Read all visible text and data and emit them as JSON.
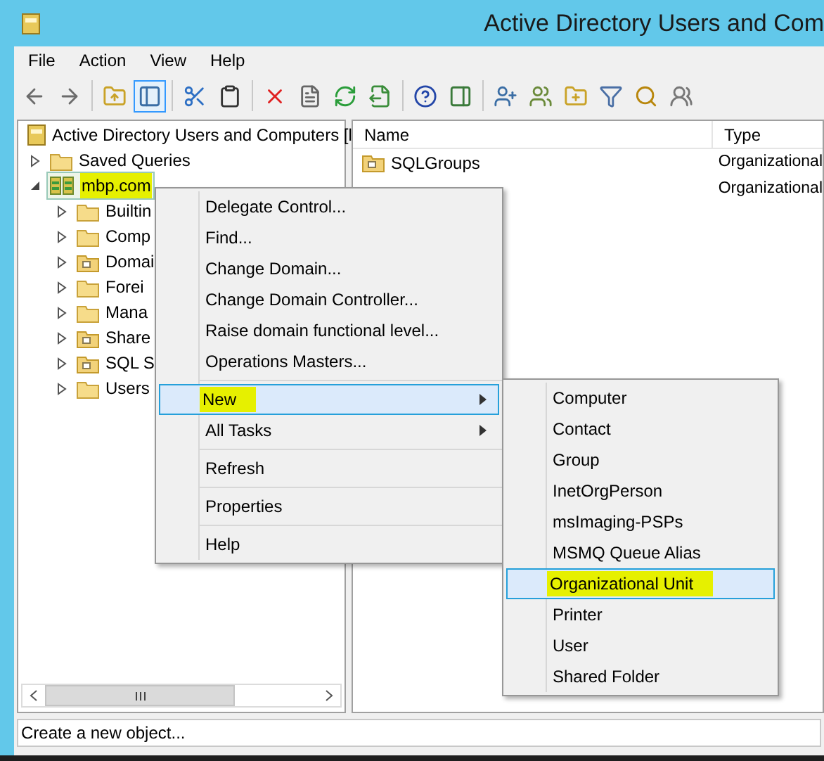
{
  "window": {
    "title": "Active Directory Users and Com"
  },
  "menu_bar": [
    "File",
    "Action",
    "View",
    "Help"
  ],
  "toolbar_buttons": [
    {
      "pressed": false
    },
    {
      "pressed": false
    },
    {
      "pressed": false
    },
    {
      "pressed": true
    },
    {
      "pressed": false
    },
    {
      "pressed": false
    },
    {
      "pressed": false
    },
    {
      "pressed": false
    },
    {
      "pressed": false
    },
    {
      "pressed": false
    },
    {
      "pressed": false
    },
    {
      "pressed": false
    },
    {
      "pressed": false
    },
    {
      "pressed": false
    },
    {
      "pressed": false
    },
    {
      "pressed": false
    },
    {
      "pressed": false
    },
    {
      "pressed": false
    }
  ],
  "tree": [
    {
      "label": "Active Directory Users and Computers [l",
      "kind": "root",
      "selected": false,
      "highlighted": false,
      "children": [
        {
          "label": "Saved Queries",
          "kind": "folder",
          "expanded": false,
          "selected": false,
          "highlighted": false
        },
        {
          "label": "mbp.com",
          "kind": "domain",
          "expanded": true,
          "selected": true,
          "highlighted": true,
          "children": [
            {
              "label": "Builtin",
              "kind": "folder",
              "expanded": false,
              "selected": false,
              "highlighted": false
            },
            {
              "label": "Comp",
              "kind": "folder",
              "expanded": false,
              "selected": false,
              "highlighted": false
            },
            {
              "label": "Domai",
              "kind": "ou",
              "expanded": false,
              "selected": false,
              "highlighted": false
            },
            {
              "label": "Forei",
              "kind": "folder",
              "expanded": false,
              "selected": false,
              "highlighted": false
            },
            {
              "label": "Mana",
              "kind": "folder",
              "expanded": false,
              "selected": false,
              "highlighted": false
            },
            {
              "label": "Share",
              "kind": "ou",
              "expanded": false,
              "selected": false,
              "highlighted": false
            },
            {
              "label": "SQL S",
              "kind": "ou",
              "expanded": false,
              "selected": false,
              "highlighted": false
            },
            {
              "label": "Users",
              "kind": "folder",
              "expanded": false,
              "selected": false,
              "highlighted": false
            }
          ]
        }
      ]
    }
  ],
  "list": {
    "columns": [
      "Name",
      "Type"
    ],
    "rows": [
      {
        "name": "SQLGroups",
        "type": "Organizational"
      },
      {
        "type": "Organizational"
      }
    ]
  },
  "context_menu": [
    {
      "kind": "item",
      "label": "Delegate Control...",
      "selected": false,
      "highlighted": false,
      "submenu": false
    },
    {
      "kind": "item",
      "label": "Find...",
      "selected": false,
      "highlighted": false,
      "submenu": false
    },
    {
      "kind": "item",
      "label": "Change Domain...",
      "selected": false,
      "highlighted": false,
      "submenu": false
    },
    {
      "kind": "item",
      "label": "Change Domain Controller...",
      "selected": false,
      "highlighted": false,
      "submenu": false
    },
    {
      "kind": "item",
      "label": "Raise domain functional level...",
      "selected": false,
      "highlighted": false,
      "submenu": false
    },
    {
      "kind": "item",
      "label": "Operations Masters...",
      "selected": false,
      "highlighted": false,
      "submenu": false
    },
    {
      "kind": "separator"
    },
    {
      "kind": "item",
      "label": "New",
      "selected": true,
      "highlighted": true,
      "submenu": true
    },
    {
      "kind": "item",
      "label": "All Tasks",
      "selected": false,
      "highlighted": false,
      "submenu": true
    },
    {
      "kind": "separator"
    },
    {
      "kind": "item",
      "label": "Refresh",
      "selected": false,
      "highlighted": false,
      "submenu": false
    },
    {
      "kind": "separator"
    },
    {
      "kind": "item",
      "label": "Properties",
      "selected": false,
      "highlighted": false,
      "submenu": false
    },
    {
      "kind": "separator"
    },
    {
      "kind": "item",
      "label": "Help",
      "selected": false,
      "highlighted": false,
      "submenu": false
    }
  ],
  "submenu": [
    {
      "label": "Computer",
      "selected": false,
      "highlighted": false
    },
    {
      "label": "Contact",
      "selected": false,
      "highlighted": false
    },
    {
      "label": "Group",
      "selected": false,
      "highlighted": false
    },
    {
      "label": "InetOrgPerson",
      "selected": false,
      "highlighted": false
    },
    {
      "label": "msImaging-PSPs",
      "selected": false,
      "highlighted": false
    },
    {
      "label": "MSMQ Queue Alias",
      "selected": false,
      "highlighted": false
    },
    {
      "label": "Organizational Unit",
      "selected": true,
      "highlighted": true
    },
    {
      "label": "Printer",
      "selected": false,
      "highlighted": false
    },
    {
      "label": "User",
      "selected": false,
      "highlighted": false
    },
    {
      "label": "Shared Folder",
      "selected": false,
      "highlighted": false
    }
  ],
  "status_bar": "Create a new object..."
}
